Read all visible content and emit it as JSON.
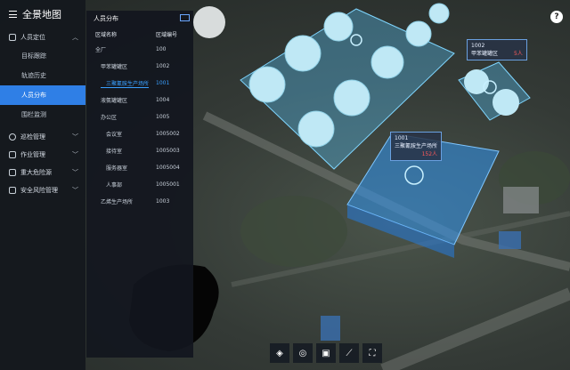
{
  "app_title": "全景地图",
  "sidebar": {
    "items": [
      {
        "label": "人员定位",
        "expanded": true,
        "children": [
          {
            "label": "目标跟踪"
          },
          {
            "label": "轨迹历史"
          },
          {
            "label": "人员分布",
            "active": true
          },
          {
            "label": "围栏监测"
          }
        ]
      },
      {
        "label": "巡检管理"
      },
      {
        "label": "作业管理"
      },
      {
        "label": "重大危险源"
      },
      {
        "label": "安全风险管理"
      }
    ]
  },
  "panel": {
    "title": "人员分布",
    "col_name": "区域名称",
    "col_code": "区域编号",
    "rows": [
      {
        "name": "全厂",
        "code": "100",
        "level": 0
      },
      {
        "name": "甲苯罐罐区",
        "code": "1002",
        "level": 1
      },
      {
        "name": "三聚氰胺生产场所",
        "code": "1001",
        "level": 1,
        "selected": true
      },
      {
        "name": "液氨罐罐区",
        "code": "1004",
        "level": 1
      },
      {
        "name": "办公区",
        "code": "1005",
        "level": 1
      },
      {
        "name": "会议室",
        "code": "1005002",
        "level": 2
      },
      {
        "name": "接待室",
        "code": "1005003",
        "level": 2
      },
      {
        "name": "服务器室",
        "code": "1005004",
        "level": 2
      },
      {
        "name": "人事部",
        "code": "1005001",
        "level": 2
      },
      {
        "name": "乙烯生产场所",
        "code": "1003",
        "level": 1
      }
    ]
  },
  "map_tags": [
    {
      "code": "1001",
      "name": "三聚氰胺生产场所",
      "count": "152人"
    },
    {
      "code": "1002",
      "name": "甲苯罐罐区",
      "count": "5人"
    }
  ],
  "toolbar": [
    "layers-icon",
    "compass-icon",
    "image-icon",
    "measure-icon",
    "fullscreen-icon"
  ],
  "help_label": "?"
}
